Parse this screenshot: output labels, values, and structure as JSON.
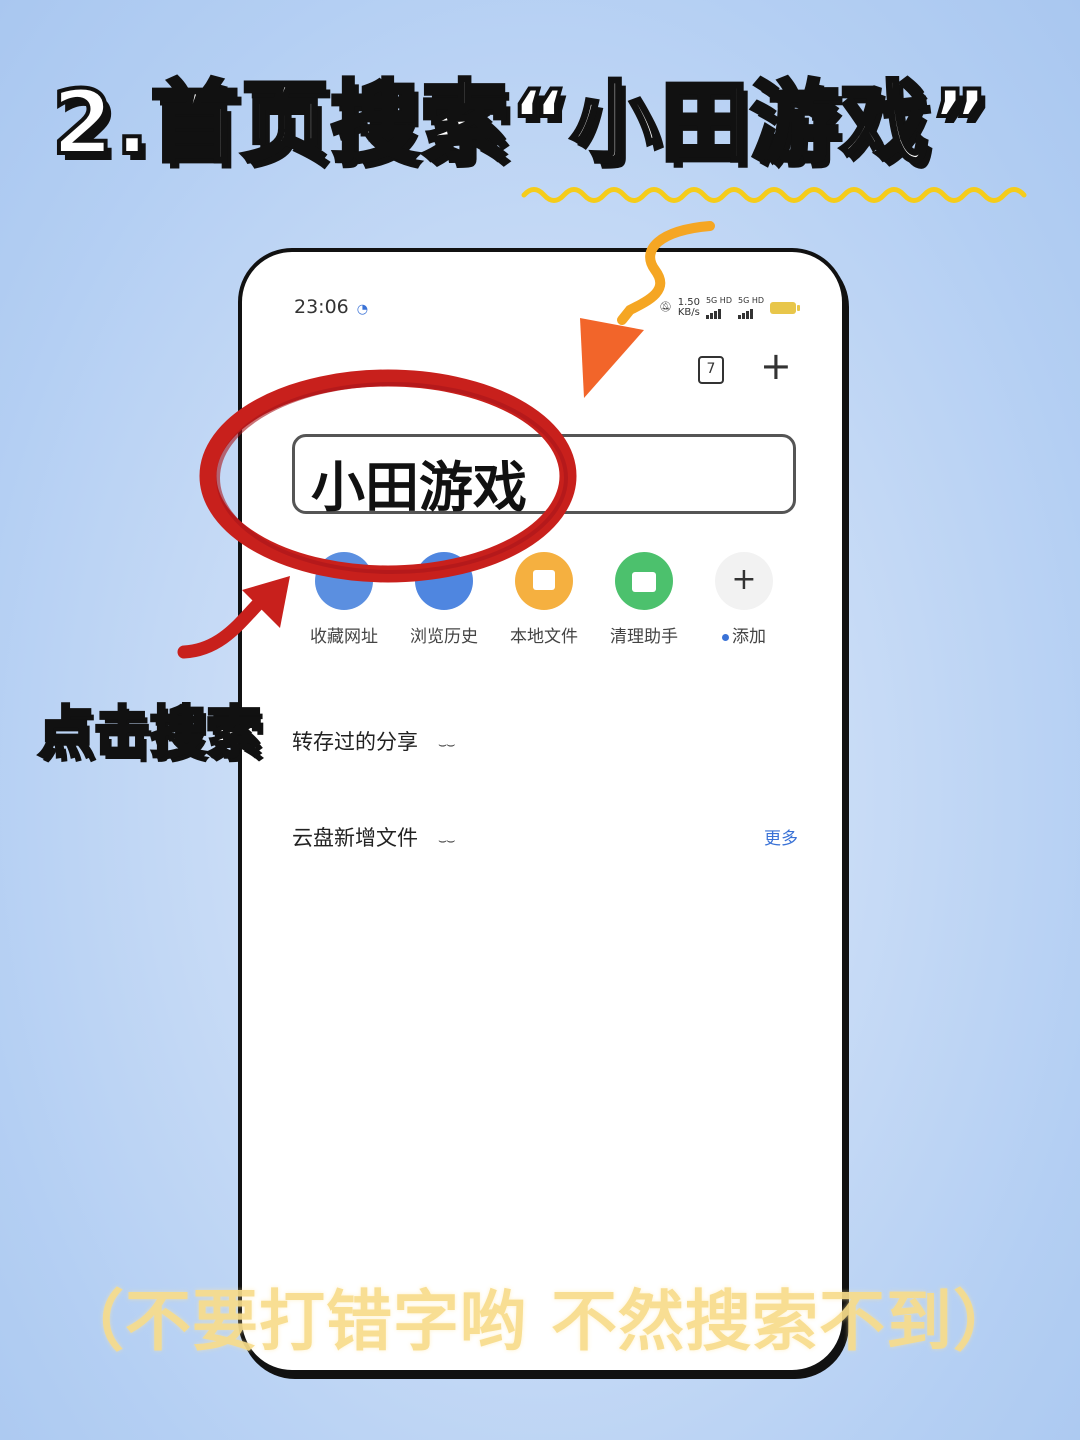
{
  "headline": "2.首页搜索“小田游戏”",
  "phone": {
    "status_bar": {
      "time": "23:06",
      "net_speed": "1.50",
      "net_unit": "KB/s",
      "sim1": "5G HD",
      "sim2": "5G HD"
    },
    "tab_count": "7",
    "search": {
      "value": "小田游戏"
    },
    "shortcuts": [
      {
        "label": "收藏网址",
        "color": "#5b8fe0"
      },
      {
        "label": "浏览历史",
        "color": "#4f86e0"
      },
      {
        "label": "本地文件",
        "color": "#f5b040"
      },
      {
        "label": "清理助手",
        "color": "#4cc16d"
      },
      {
        "label": "添加",
        "color": "#f2f2f2"
      }
    ],
    "sections": [
      {
        "title": "转存过的分享"
      },
      {
        "title": "云盘新增文件",
        "more": "更多"
      }
    ]
  },
  "annotation": {
    "tap_label": "点击搜索"
  },
  "footnote": "（不要打错字哟 不然搜索不到）",
  "colors": {
    "ellipse": "#c8201c",
    "arrow_orange": "#f5a623",
    "arrow_red": "#c8201c",
    "squiggle": "#f5cc1a"
  }
}
